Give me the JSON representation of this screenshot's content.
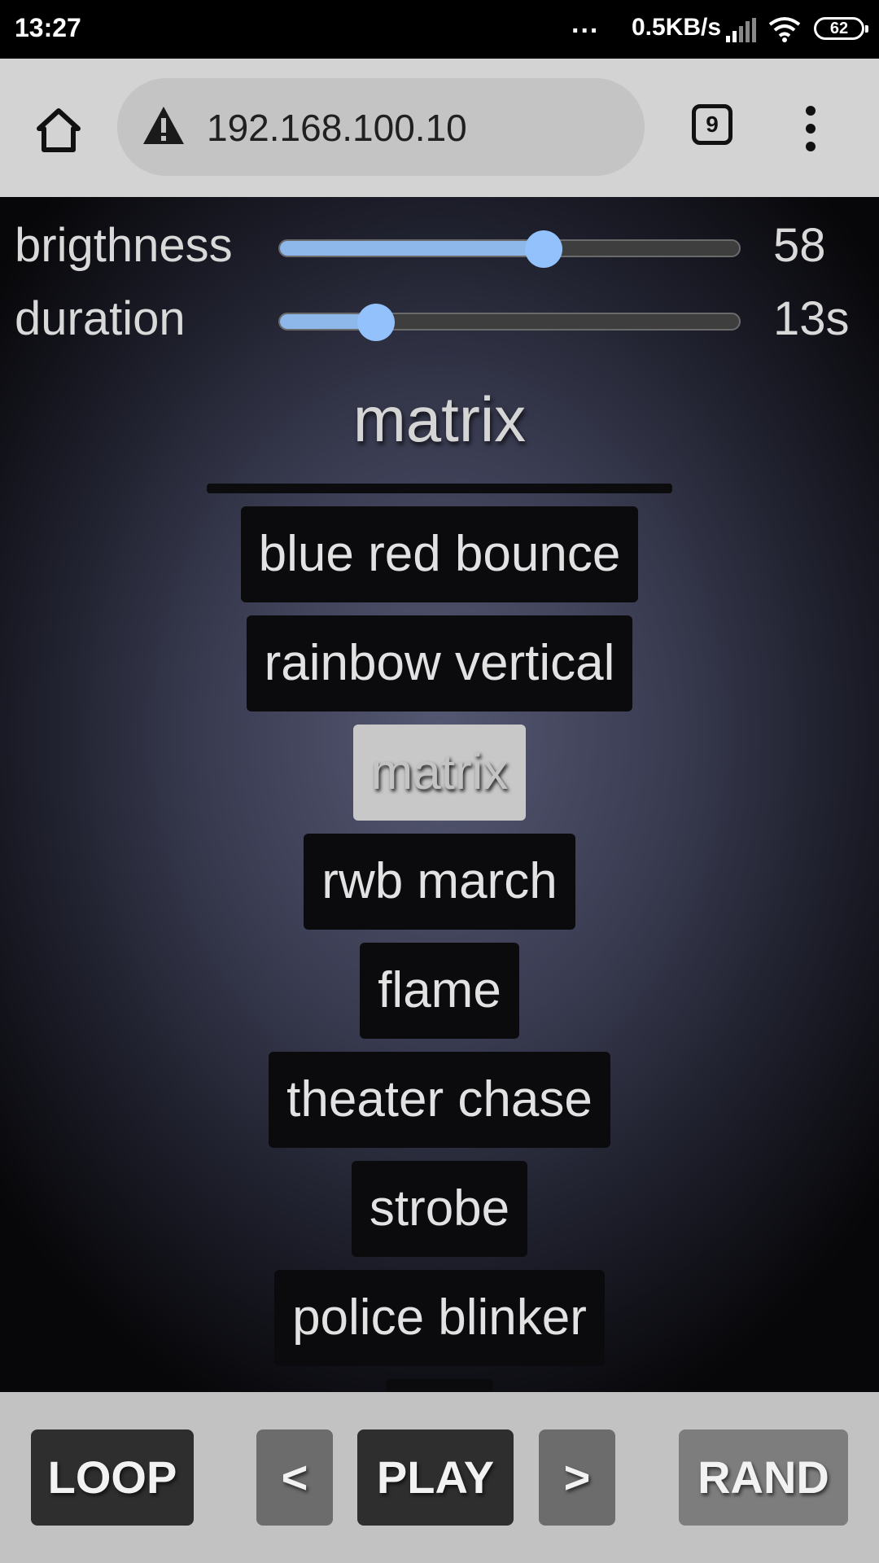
{
  "status_bar": {
    "time": "13:27",
    "dots": "...",
    "net_speed": "0.5KB/s",
    "battery": "62"
  },
  "browser": {
    "url": "192.168.100.10",
    "tab_count": "9"
  },
  "controls_top": {
    "brightness": {
      "label": "brigthness",
      "value": "58",
      "fraction": 0.575
    },
    "duration": {
      "label": "duration",
      "value": "13s",
      "fraction": 0.21
    }
  },
  "current_effect": "matrix",
  "effects": [
    {
      "label": "blue red bounce",
      "active": false
    },
    {
      "label": "rainbow vertical",
      "active": false
    },
    {
      "label": "matrix",
      "active": true
    },
    {
      "label": "rwb march",
      "active": false
    },
    {
      "label": "flame",
      "active": false
    },
    {
      "label": "theater chase",
      "active": false
    },
    {
      "label": "strobe",
      "active": false
    },
    {
      "label": "police blinker",
      "active": false
    },
    {
      "label": "",
      "active": false
    }
  ],
  "bottom_controls": {
    "loop": "LOOP",
    "prev": "<",
    "play": "PLAY",
    "next": ">",
    "rand": "RAND"
  }
}
